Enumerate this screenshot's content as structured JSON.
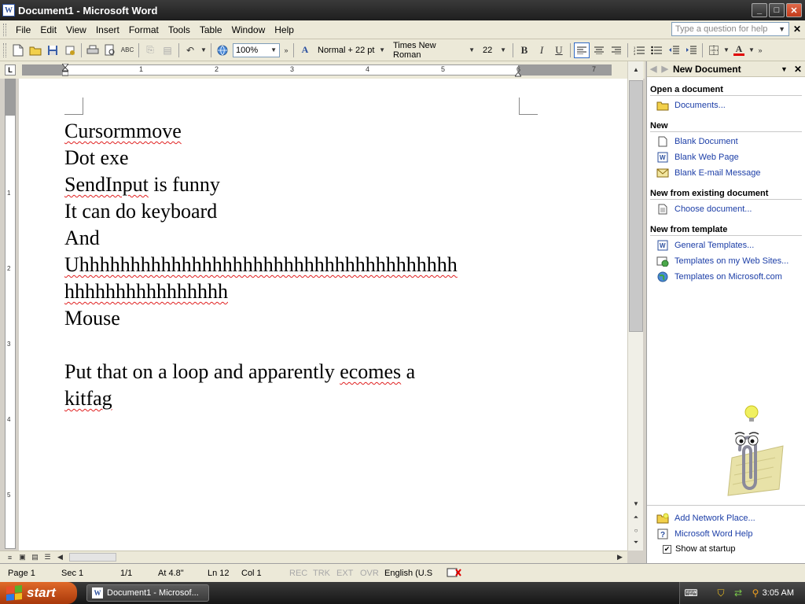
{
  "window": {
    "title": "Document1 - Microsoft Word",
    "app_icon_letter": "W",
    "min_btn": "_",
    "max_btn": "□",
    "close_btn": "✕"
  },
  "menu": {
    "items": [
      "File",
      "Edit",
      "View",
      "Insert",
      "Format",
      "Tools",
      "Table",
      "Window",
      "Help"
    ],
    "help_placeholder": "Type a question for help",
    "doc_close": "✕"
  },
  "toolbar": {
    "zoom": "100%",
    "style": "Normal + 22 pt",
    "font": "Times New Roman",
    "size": "22",
    "bold": "B",
    "italic": "I",
    "underline": "U",
    "font_color_letter": "A"
  },
  "ruler": {
    "numbers": [
      "1",
      "2",
      "3",
      "4",
      "5",
      "6",
      "7"
    ],
    "vnumbers": [
      "1",
      "2",
      "3",
      "4",
      "5"
    ],
    "tab_selector": "L"
  },
  "document": {
    "lines": [
      {
        "parts": [
          {
            "t": "Cursormmove",
            "sp": true
          }
        ]
      },
      {
        "parts": [
          {
            "t": "Dot exe",
            "sp": false
          }
        ]
      },
      {
        "parts": [
          {
            "t": "SendInput",
            "sp": true
          },
          {
            "t": " is funny",
            "sp": false
          }
        ]
      },
      {
        "parts": [
          {
            "t": "It can do keyboard",
            "sp": false
          }
        ]
      },
      {
        "parts": [
          {
            "t": "And",
            "sp": false
          }
        ]
      },
      {
        "parts": [
          {
            "t": "Uhhhhhhhhhhhhhhhhhhhhhhhhhhhhhhhhhhhhh",
            "sp": true
          }
        ]
      },
      {
        "parts": [
          {
            "t": "hhhhhhhhhhhhhhhh",
            "sp": true
          }
        ]
      },
      {
        "parts": [
          {
            "t": "Mouse",
            "sp": false
          }
        ]
      },
      {
        "parts": [
          {
            "t": "",
            "sp": false
          }
        ]
      },
      {
        "parts": [
          {
            "t": "Put that on a loop and apparently ",
            "sp": false
          },
          {
            "t": "ecomes",
            "sp": true
          },
          {
            "t": " a",
            "sp": false
          }
        ]
      },
      {
        "parts": [
          {
            "t": "kitfag",
            "sp": true
          }
        ]
      }
    ]
  },
  "taskpane": {
    "title": "New Document",
    "sections": [
      {
        "heading": "Open a document",
        "links": [
          {
            "label": "Documents...",
            "icon": "folder-icon"
          }
        ]
      },
      {
        "heading": "New",
        "links": [
          {
            "label": "Blank Document",
            "icon": "blank-document-icon"
          },
          {
            "label": "Blank Web Page",
            "icon": "web-page-icon"
          },
          {
            "label": "Blank E-mail Message",
            "icon": "email-icon"
          }
        ]
      },
      {
        "heading": "New from existing document",
        "links": [
          {
            "label": "Choose document...",
            "icon": "document-icon"
          }
        ]
      },
      {
        "heading": "New from template",
        "links": [
          {
            "label": "General Templates...",
            "icon": "template-icon"
          },
          {
            "label": "Templates on my Web Sites...",
            "icon": "web-templates-icon"
          },
          {
            "label": "Templates on Microsoft.com",
            "icon": "globe-icon"
          }
        ]
      }
    ],
    "bottom_links": [
      {
        "label": "Add Network Place...",
        "icon": "network-place-icon"
      },
      {
        "label": "Microsoft Word Help",
        "icon": "help-icon"
      }
    ],
    "show_at_startup": "Show at startup",
    "show_at_startup_checked": true
  },
  "statusbar": {
    "page": "Page 1",
    "sec": "Sec 1",
    "pages": "1/1",
    "at": "At 4.8\"",
    "ln": "Ln 12",
    "col": "Col 1",
    "rec": "REC",
    "trk": "TRK",
    "ext": "EXT",
    "ovr": "OVR",
    "language": "English (U.S"
  },
  "taskbar": {
    "start": "start",
    "task_label": "Document1 - Microsof...",
    "clock": "3:05 AM"
  },
  "colors": {
    "spell_underline": "#e02020",
    "link": "#1c3ea7",
    "start_button": "#c84a14"
  }
}
